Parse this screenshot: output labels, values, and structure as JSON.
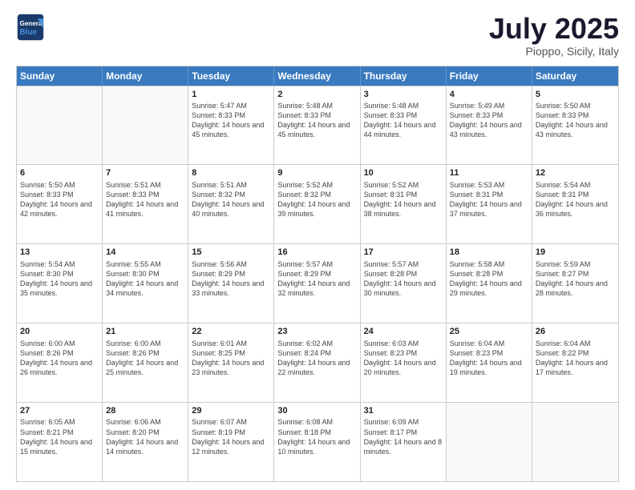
{
  "header": {
    "logo_general": "General",
    "logo_blue": "Blue",
    "month_title": "July 2025",
    "location": "Pioppo, Sicily, Italy"
  },
  "weekdays": [
    "Sunday",
    "Monday",
    "Tuesday",
    "Wednesday",
    "Thursday",
    "Friday",
    "Saturday"
  ],
  "rows": [
    [
      {
        "day": "",
        "info": ""
      },
      {
        "day": "",
        "info": ""
      },
      {
        "day": "1",
        "info": "Sunrise: 5:47 AM\nSunset: 8:33 PM\nDaylight: 14 hours and 45 minutes."
      },
      {
        "day": "2",
        "info": "Sunrise: 5:48 AM\nSunset: 8:33 PM\nDaylight: 14 hours and 45 minutes."
      },
      {
        "day": "3",
        "info": "Sunrise: 5:48 AM\nSunset: 8:33 PM\nDaylight: 14 hours and 44 minutes."
      },
      {
        "day": "4",
        "info": "Sunrise: 5:49 AM\nSunset: 8:33 PM\nDaylight: 14 hours and 43 minutes."
      },
      {
        "day": "5",
        "info": "Sunrise: 5:50 AM\nSunset: 8:33 PM\nDaylight: 14 hours and 43 minutes."
      }
    ],
    [
      {
        "day": "6",
        "info": "Sunrise: 5:50 AM\nSunset: 8:33 PM\nDaylight: 14 hours and 42 minutes."
      },
      {
        "day": "7",
        "info": "Sunrise: 5:51 AM\nSunset: 8:33 PM\nDaylight: 14 hours and 41 minutes."
      },
      {
        "day": "8",
        "info": "Sunrise: 5:51 AM\nSunset: 8:32 PM\nDaylight: 14 hours and 40 minutes."
      },
      {
        "day": "9",
        "info": "Sunrise: 5:52 AM\nSunset: 8:32 PM\nDaylight: 14 hours and 39 minutes."
      },
      {
        "day": "10",
        "info": "Sunrise: 5:52 AM\nSunset: 8:31 PM\nDaylight: 14 hours and 38 minutes."
      },
      {
        "day": "11",
        "info": "Sunrise: 5:53 AM\nSunset: 8:31 PM\nDaylight: 14 hours and 37 minutes."
      },
      {
        "day": "12",
        "info": "Sunrise: 5:54 AM\nSunset: 8:31 PM\nDaylight: 14 hours and 36 minutes."
      }
    ],
    [
      {
        "day": "13",
        "info": "Sunrise: 5:54 AM\nSunset: 8:30 PM\nDaylight: 14 hours and 35 minutes."
      },
      {
        "day": "14",
        "info": "Sunrise: 5:55 AM\nSunset: 8:30 PM\nDaylight: 14 hours and 34 minutes."
      },
      {
        "day": "15",
        "info": "Sunrise: 5:56 AM\nSunset: 8:29 PM\nDaylight: 14 hours and 33 minutes."
      },
      {
        "day": "16",
        "info": "Sunrise: 5:57 AM\nSunset: 8:29 PM\nDaylight: 14 hours and 32 minutes."
      },
      {
        "day": "17",
        "info": "Sunrise: 5:57 AM\nSunset: 8:28 PM\nDaylight: 14 hours and 30 minutes."
      },
      {
        "day": "18",
        "info": "Sunrise: 5:58 AM\nSunset: 8:28 PM\nDaylight: 14 hours and 29 minutes."
      },
      {
        "day": "19",
        "info": "Sunrise: 5:59 AM\nSunset: 8:27 PM\nDaylight: 14 hours and 28 minutes."
      }
    ],
    [
      {
        "day": "20",
        "info": "Sunrise: 6:00 AM\nSunset: 8:26 PM\nDaylight: 14 hours and 26 minutes."
      },
      {
        "day": "21",
        "info": "Sunrise: 6:00 AM\nSunset: 8:26 PM\nDaylight: 14 hours and 25 minutes."
      },
      {
        "day": "22",
        "info": "Sunrise: 6:01 AM\nSunset: 8:25 PM\nDaylight: 14 hours and 23 minutes."
      },
      {
        "day": "23",
        "info": "Sunrise: 6:02 AM\nSunset: 8:24 PM\nDaylight: 14 hours and 22 minutes."
      },
      {
        "day": "24",
        "info": "Sunrise: 6:03 AM\nSunset: 8:23 PM\nDaylight: 14 hours and 20 minutes."
      },
      {
        "day": "25",
        "info": "Sunrise: 6:04 AM\nSunset: 8:23 PM\nDaylight: 14 hours and 19 minutes."
      },
      {
        "day": "26",
        "info": "Sunrise: 6:04 AM\nSunset: 8:22 PM\nDaylight: 14 hours and 17 minutes."
      }
    ],
    [
      {
        "day": "27",
        "info": "Sunrise: 6:05 AM\nSunset: 8:21 PM\nDaylight: 14 hours and 15 minutes."
      },
      {
        "day": "28",
        "info": "Sunrise: 6:06 AM\nSunset: 8:20 PM\nDaylight: 14 hours and 14 minutes."
      },
      {
        "day": "29",
        "info": "Sunrise: 6:07 AM\nSunset: 8:19 PM\nDaylight: 14 hours and 12 minutes."
      },
      {
        "day": "30",
        "info": "Sunrise: 6:08 AM\nSunset: 8:18 PM\nDaylight: 14 hours and 10 minutes."
      },
      {
        "day": "31",
        "info": "Sunrise: 6:09 AM\nSunset: 8:17 PM\nDaylight: 14 hours and 8 minutes."
      },
      {
        "day": "",
        "info": ""
      },
      {
        "day": "",
        "info": ""
      }
    ]
  ]
}
